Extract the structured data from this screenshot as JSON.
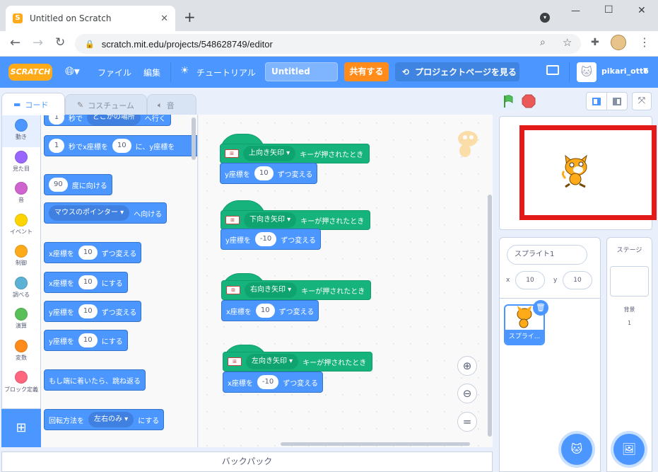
{
  "browser": {
    "tab_title": "Untitled on Scratch",
    "new_tab": "+",
    "url": "scratch.mit.edu/projects/548628749/editor",
    "window_controls": [
      "—",
      "☐",
      "✕"
    ]
  },
  "menubar": {
    "logo": "SCRATCH",
    "file": "ファイル",
    "edit": "編集",
    "tutorial": "チュートリアル",
    "project_title": "Untitled",
    "share": "共有する",
    "see_project_page": "プロジェクトページを見る",
    "username": "pikari_otto"
  },
  "tabs": {
    "code": "コード",
    "costumes": "コスチューム",
    "sounds": "音"
  },
  "categories": [
    {
      "label": "動き",
      "color": "#4c97ff"
    },
    {
      "label": "見た目",
      "color": "#9966ff"
    },
    {
      "label": "音",
      "color": "#cf63cf"
    },
    {
      "label": "イベント",
      "color": "#ffd500"
    },
    {
      "label": "制御",
      "color": "#ffab19"
    },
    {
      "label": "調べる",
      "color": "#5cb1d6"
    },
    {
      "label": "演算",
      "color": "#59c059"
    },
    {
      "label": "変数",
      "color": "#ff8c1a"
    },
    {
      "label": "ブロック定義",
      "color": "#ff6680"
    }
  ],
  "palette": {
    "b0": {
      "n1": "1",
      "t1": "秒で",
      "dd": "どこかの場所",
      "t2": "へ行く"
    },
    "b1": {
      "n1": "1",
      "t1": "秒でx座標を",
      "n2": "10",
      "t2": "に、y座標を"
    },
    "b2": {
      "n1": "90",
      "t1": "度に向ける"
    },
    "b3": {
      "dd": "マウスのポインター",
      "t1": "へ向ける"
    },
    "b4": {
      "t1": "x座標を",
      "n1": "10",
      "t2": "ずつ変える"
    },
    "b5": {
      "t1": "x座標を",
      "n1": "10",
      "t2": "にする"
    },
    "b6": {
      "t1": "y座標を",
      "n1": "10",
      "t2": "ずつ変える"
    },
    "b7": {
      "t1": "y座標を",
      "n1": "10",
      "t2": "にする"
    },
    "b8": {
      "t1": "もし端に着いたら、跳ね返る"
    },
    "b9": {
      "t1": "回転方法を",
      "dd": "左右のみ",
      "t2": "にする"
    }
  },
  "scripts": [
    {
      "key": "上向き矢印",
      "hat": "キーが押されたとき",
      "stmt": "y座標を",
      "val": "10",
      "stmt2": "ずつ変える"
    },
    {
      "key": "下向き矢印",
      "hat": "キーが押されたとき",
      "stmt": "y座標を",
      "val": "-10",
      "stmt2": "ずつ変える"
    },
    {
      "key": "右向き矢印",
      "hat": "キーが押されたとき",
      "stmt": "x座標を",
      "val": "10",
      "stmt2": "ずつ変える"
    },
    {
      "key": "左向き矢印",
      "hat": "キーが押されたとき",
      "stmt": "x座標を",
      "val": "-10",
      "stmt2": "ずつ変える"
    }
  ],
  "backpack": "バックパック",
  "sprite_info": {
    "name": "スプライト1",
    "x_label": "x",
    "x": "10",
    "y_label": "y",
    "y": "10",
    "thumb_label": "スプライ..."
  },
  "stage_panel": {
    "title": "ステージ",
    "backdrops_label": "背景",
    "backdrops_count": "1"
  },
  "colors": {
    "header": "#4c97ff",
    "share": "#ff8c1a",
    "motion": "#4c97ff",
    "event": "#17b37d",
    "stage_border": "#e21a1a"
  }
}
